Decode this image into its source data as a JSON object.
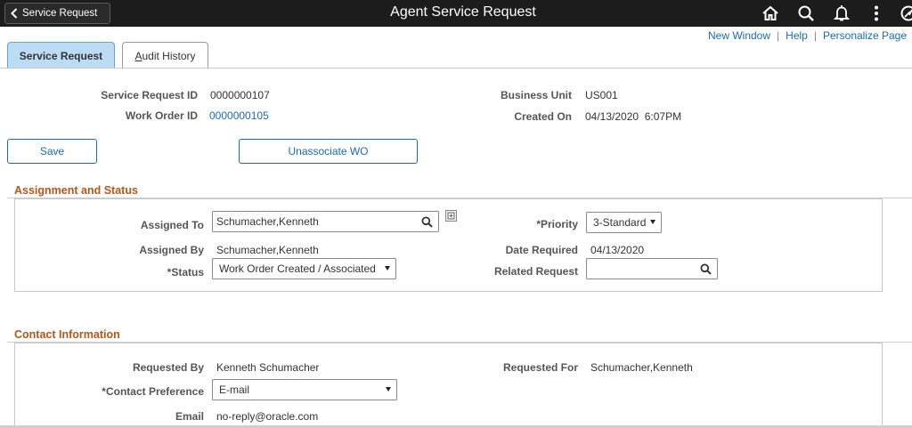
{
  "header": {
    "back_label": "Service Request",
    "title": "Agent Service Request",
    "icons": [
      "home-icon",
      "search-icon",
      "notification-icon",
      "more-icon",
      "navbar-icon"
    ]
  },
  "links": {
    "new_window": "New Window",
    "help": "Help",
    "personalize": "Personalize Page",
    "separator": "|"
  },
  "tabs": [
    {
      "label": "Service Request",
      "active": true
    },
    {
      "label": "Audit History",
      "accesskey": "A",
      "active": false
    }
  ],
  "summary": {
    "service_request_id_label": "Service Request ID",
    "service_request_id": "0000000107",
    "work_order_id_label": "Work Order ID",
    "work_order_id": "0000000105",
    "business_unit_label": "Business Unit",
    "business_unit": "US001",
    "created_on_label": "Created On",
    "created_on": "04/13/2020  6:07PM"
  },
  "buttons": {
    "save": "Save",
    "unassociate": "Unassociate WO"
  },
  "assignment": {
    "title": "Assignment and Status",
    "assigned_to_label": "Assigned To",
    "assigned_to": "Schumacher,Kenneth",
    "priority_label": "*Priority",
    "priority": "3-Standard",
    "assigned_by_label": "Assigned By",
    "assigned_by": "Schumacher,Kenneth",
    "date_required_label": "Date Required",
    "date_required": "04/13/2020",
    "status_label": "*Status",
    "status": "Work Order Created / Associated",
    "related_request_label": "Related Request",
    "related_request": ""
  },
  "contact": {
    "title": "Contact Information",
    "requested_by_label": "Requested By",
    "requested_by": "Kenneth Schumacher",
    "requested_for_label": "Requested For",
    "requested_for": "Schumacher,Kenneth",
    "contact_pref_label": "*Contact Preference",
    "contact_pref": "E-mail",
    "email_label": "Email",
    "email": "no-reply@oracle.com"
  },
  "colors": {
    "header_bg": "#1c1c1c",
    "link": "#1a6bb5",
    "section_title": "#b5561b",
    "active_tab": "#bcdcf6"
  }
}
